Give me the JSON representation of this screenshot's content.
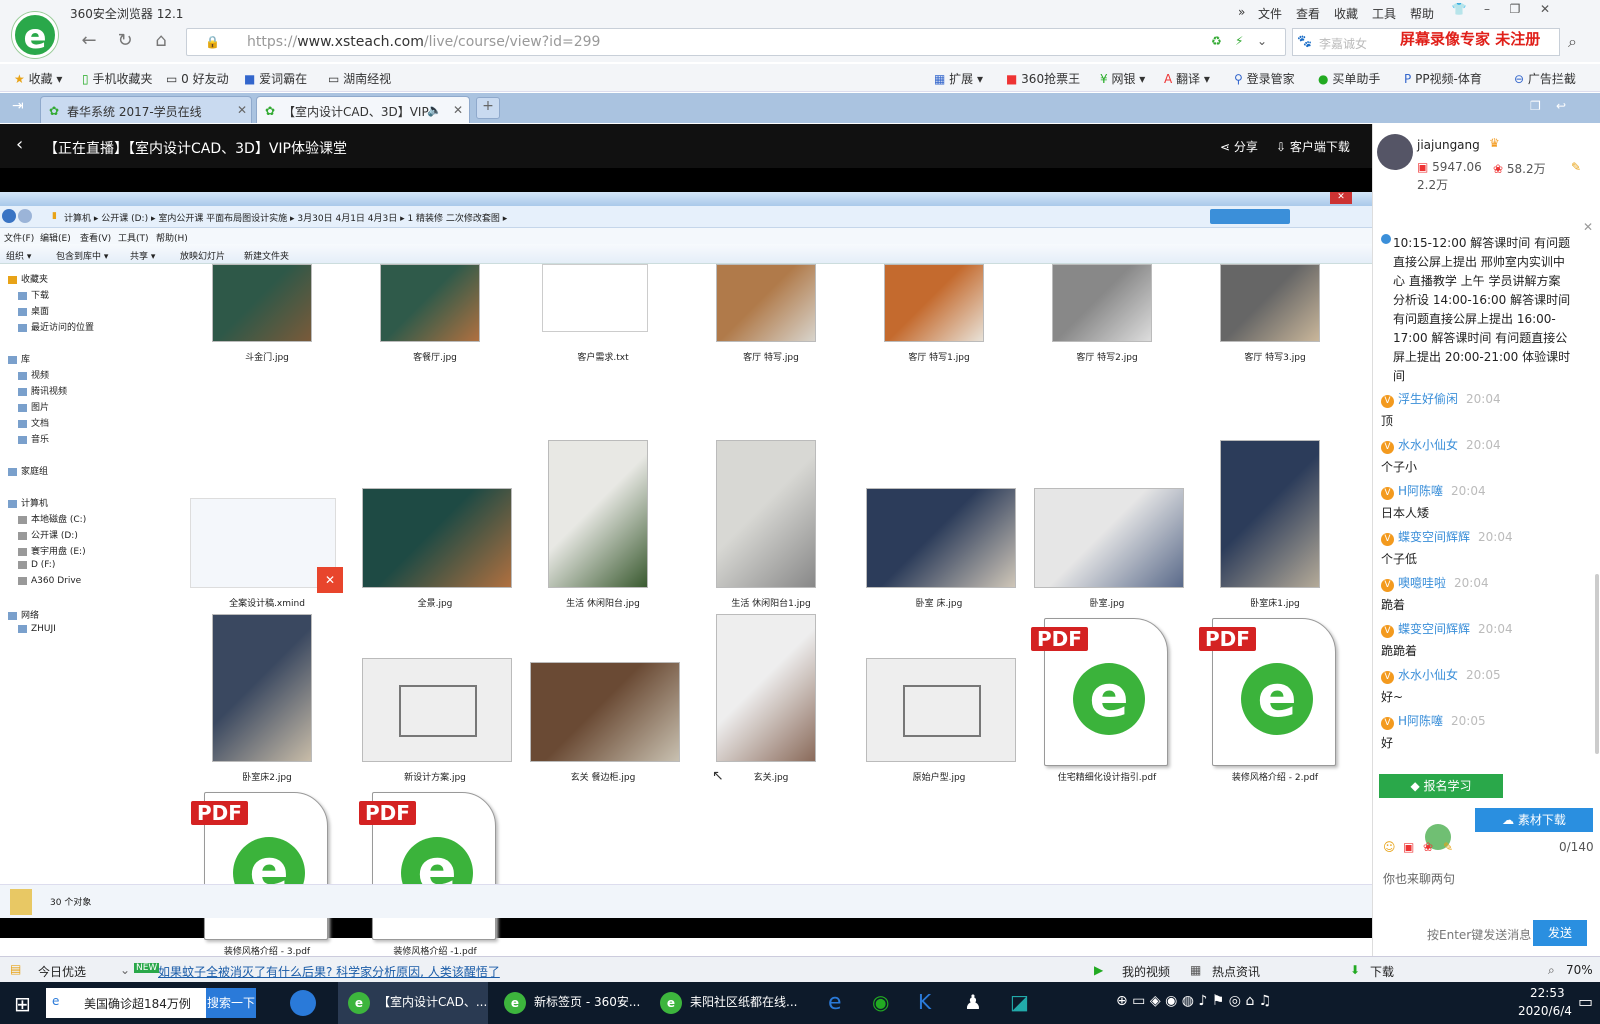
{
  "browser": {
    "title": "360安全浏览器 12.1",
    "menu": [
      "文件",
      "查看",
      "收藏",
      "工具",
      "帮助"
    ],
    "url_prefix": "https://",
    "url_host": "www.xsteach.com",
    "url_path": "/live/course/view?id=299",
    "search_placeholder": "李嘉诚女",
    "watermark": "屏幕录像专家  未注册"
  },
  "bookmarks": [
    {
      "label": "收藏"
    },
    {
      "label": "手机收藏夹"
    },
    {
      "label": "0 好友动"
    },
    {
      "label": "爱词霸在"
    },
    {
      "label": "湖南经视"
    },
    {
      "label": "扩展"
    },
    {
      "label": "360抢票王"
    },
    {
      "label": "网银"
    },
    {
      "label": "翻译"
    },
    {
      "label": "登录管家"
    },
    {
      "label": "买单助手"
    },
    {
      "label": "PP视频-体育"
    },
    {
      "label": "广告拦截"
    }
  ],
  "tabs": [
    {
      "label": "春华系统 2017-学员在线"
    },
    {
      "label": "【室内设计CAD、3D】VIP"
    }
  ],
  "header": {
    "title": "【正在直播】【室内设计CAD、3D】VIP体验课堂",
    "share": "分享",
    "download": "客户端下载"
  },
  "explorer": {
    "breadcrumb": "计算机  ▸  公开课 (D:)  ▸  室内公开课  平面布局图设计实施  ▸  3月30日  4月1日 4月3日  ▸  1  精装修  二次修改套图  ▸",
    "menu": [
      "文件(F)",
      "编辑(E)",
      "查看(V)",
      "工具(T)",
      "帮助(H)"
    ],
    "toolbar": [
      "组织 ▾",
      "包含到库中 ▾",
      "共享 ▾",
      "放映幻灯片",
      "新建文件夹"
    ],
    "nav": [
      "收藏夹",
      "下载",
      "桌面",
      "最近访问的位置",
      "库",
      "视频",
      "腾讯视频",
      "图片",
      "文档",
      "音乐",
      "家庭组",
      "计算机",
      "本地磁盘 (C:)",
      "公开课 (D:)",
      "寰宇用盘 (E:)",
      "D (F:)",
      "A360 Drive",
      "网络",
      "ZHUJI"
    ],
    "status": "30 个对象",
    "files": [
      {
        "name": "斗金门.jpg",
        "kind": "img",
        "c1": "#2e5848",
        "c2": "#7a5a3a"
      },
      {
        "name": "客餐厅.jpg",
        "kind": "img",
        "c1": "#2f5a4a",
        "c2": "#b07040"
      },
      {
        "name": "客户需求.txt",
        "kind": "txt"
      },
      {
        "name": "客厅 特写.jpg",
        "kind": "img",
        "c1": "#b07a4a",
        "c2": "#d8d4cc"
      },
      {
        "name": "客厅 特写1.jpg",
        "kind": "img",
        "c1": "#c46a2e",
        "c2": "#e8e2d8"
      },
      {
        "name": "客厅 特写2.jpg",
        "kind": "img",
        "c1": "#888",
        "c2": "#ddd"
      },
      {
        "name": "客厅 特写3.jpg",
        "kind": "img",
        "c1": "#666",
        "c2": "#c9b69a"
      },
      {
        "name": "全案设计稿.xmind",
        "kind": "xmind"
      },
      {
        "name": "全景.jpg",
        "kind": "img",
        "c1": "#1e4a44",
        "c2": "#b07040"
      },
      {
        "name": "生活 休闲阳台.jpg",
        "kind": "img",
        "c1": "#e8e8e4",
        "c2": "#3a5a30"
      },
      {
        "name": "生活 休闲阳台1.jpg",
        "kind": "img",
        "c1": "#d8d8d4",
        "c2": "#888"
      },
      {
        "name": "卧室 床.jpg",
        "kind": "img",
        "c1": "#2c3c5a",
        "c2": "#cfc6b8"
      },
      {
        "name": "卧室.jpg",
        "kind": "img",
        "c1": "#e6e6e6",
        "c2": "#5a6a8a"
      },
      {
        "name": "卧室床1.jpg",
        "kind": "img",
        "c1": "#2c3c5a",
        "c2": "#b4aa98"
      },
      {
        "name": "卧室床2.jpg",
        "kind": "img",
        "c1": "#3a4860",
        "c2": "#c8bca8"
      },
      {
        "name": "新设计方案.jpg",
        "kind": "plan"
      },
      {
        "name": "玄关 餐边柜.jpg",
        "kind": "img",
        "c1": "#6a4a34",
        "c2": "#c8c0b0"
      },
      {
        "name": "玄关.jpg",
        "kind": "img",
        "c1": "#eee",
        "c2": "#8a6a5a"
      },
      {
        "name": "原始户型.jpg",
        "kind": "plan"
      },
      {
        "name": "住宅精细化设计指引.pdf",
        "kind": "pdf",
        "tag": "PDF"
      },
      {
        "name": "装修风格介绍 - 2.pdf",
        "kind": "pdf",
        "tag": "PDF"
      },
      {
        "name": "装修风格介绍 - 3.pdf",
        "kind": "pdf",
        "tag": "PDF"
      },
      {
        "name": "装修风格介绍 -1.pdf",
        "kind": "pdf",
        "tag": "PDF"
      }
    ]
  },
  "user": {
    "name": "jiajungang",
    "stat1": "5947.06",
    "stat2": "58.2万",
    "stat3": "2.2万"
  },
  "announcement": "10:15-12:00 解答课时间 有问题直接公屏上提出 邢帅室内实训中心 直播教学 上午 学员讲解方案 分析设 14:00-16:00 解答课时间 有问题直接公屏上提出 16:00-17:00 解答课时间 有问题直接公屏上提出 20:00-21:00 体验课时间",
  "messages": [
    {
      "name": "浮生好偷闲",
      "time": "20:04",
      "text": "顶"
    },
    {
      "name": "水水小仙女",
      "time": "20:04",
      "text": "个子小"
    },
    {
      "name": "H阿陈噻",
      "time": "20:04",
      "text": "日本人矮"
    },
    {
      "name": "蝶变空间辉辉",
      "time": "20:04",
      "text": "个子低"
    },
    {
      "name": "噢噫哇啦",
      "time": "20:04",
      "text": "跪着"
    },
    {
      "name": "蝶变空间辉辉",
      "time": "20:04",
      "text": "跪跪着"
    },
    {
      "name": "水水小仙女",
      "time": "20:05",
      "text": "好~"
    },
    {
      "name": "H阿陈噻",
      "time": "20:05",
      "text": "好"
    }
  ],
  "chat": {
    "signup": "报名学习",
    "material": "素材下载",
    "counter": "0/140",
    "input_placeholder": "你也来聊两句",
    "enter_hint": "按Enter键发送消息",
    "send": "发送"
  },
  "statusbar": {
    "today": "今日优选",
    "news": "如果蚊子全被消灭了有什么后果? 科学家分析原因, 人类该醒悟了",
    "myvideo": "我的视频",
    "hot": "热点资讯",
    "download": "下载",
    "zoom": "70%"
  },
  "taskbar": {
    "items": [
      "美国确诊超184万例",
      "搜索一下",
      "【室内设计CAD、...",
      "新标签页 - 360安...",
      "耒阳社区纸都在线..."
    ],
    "time": "22:53",
    "date": "2020/6/4"
  }
}
